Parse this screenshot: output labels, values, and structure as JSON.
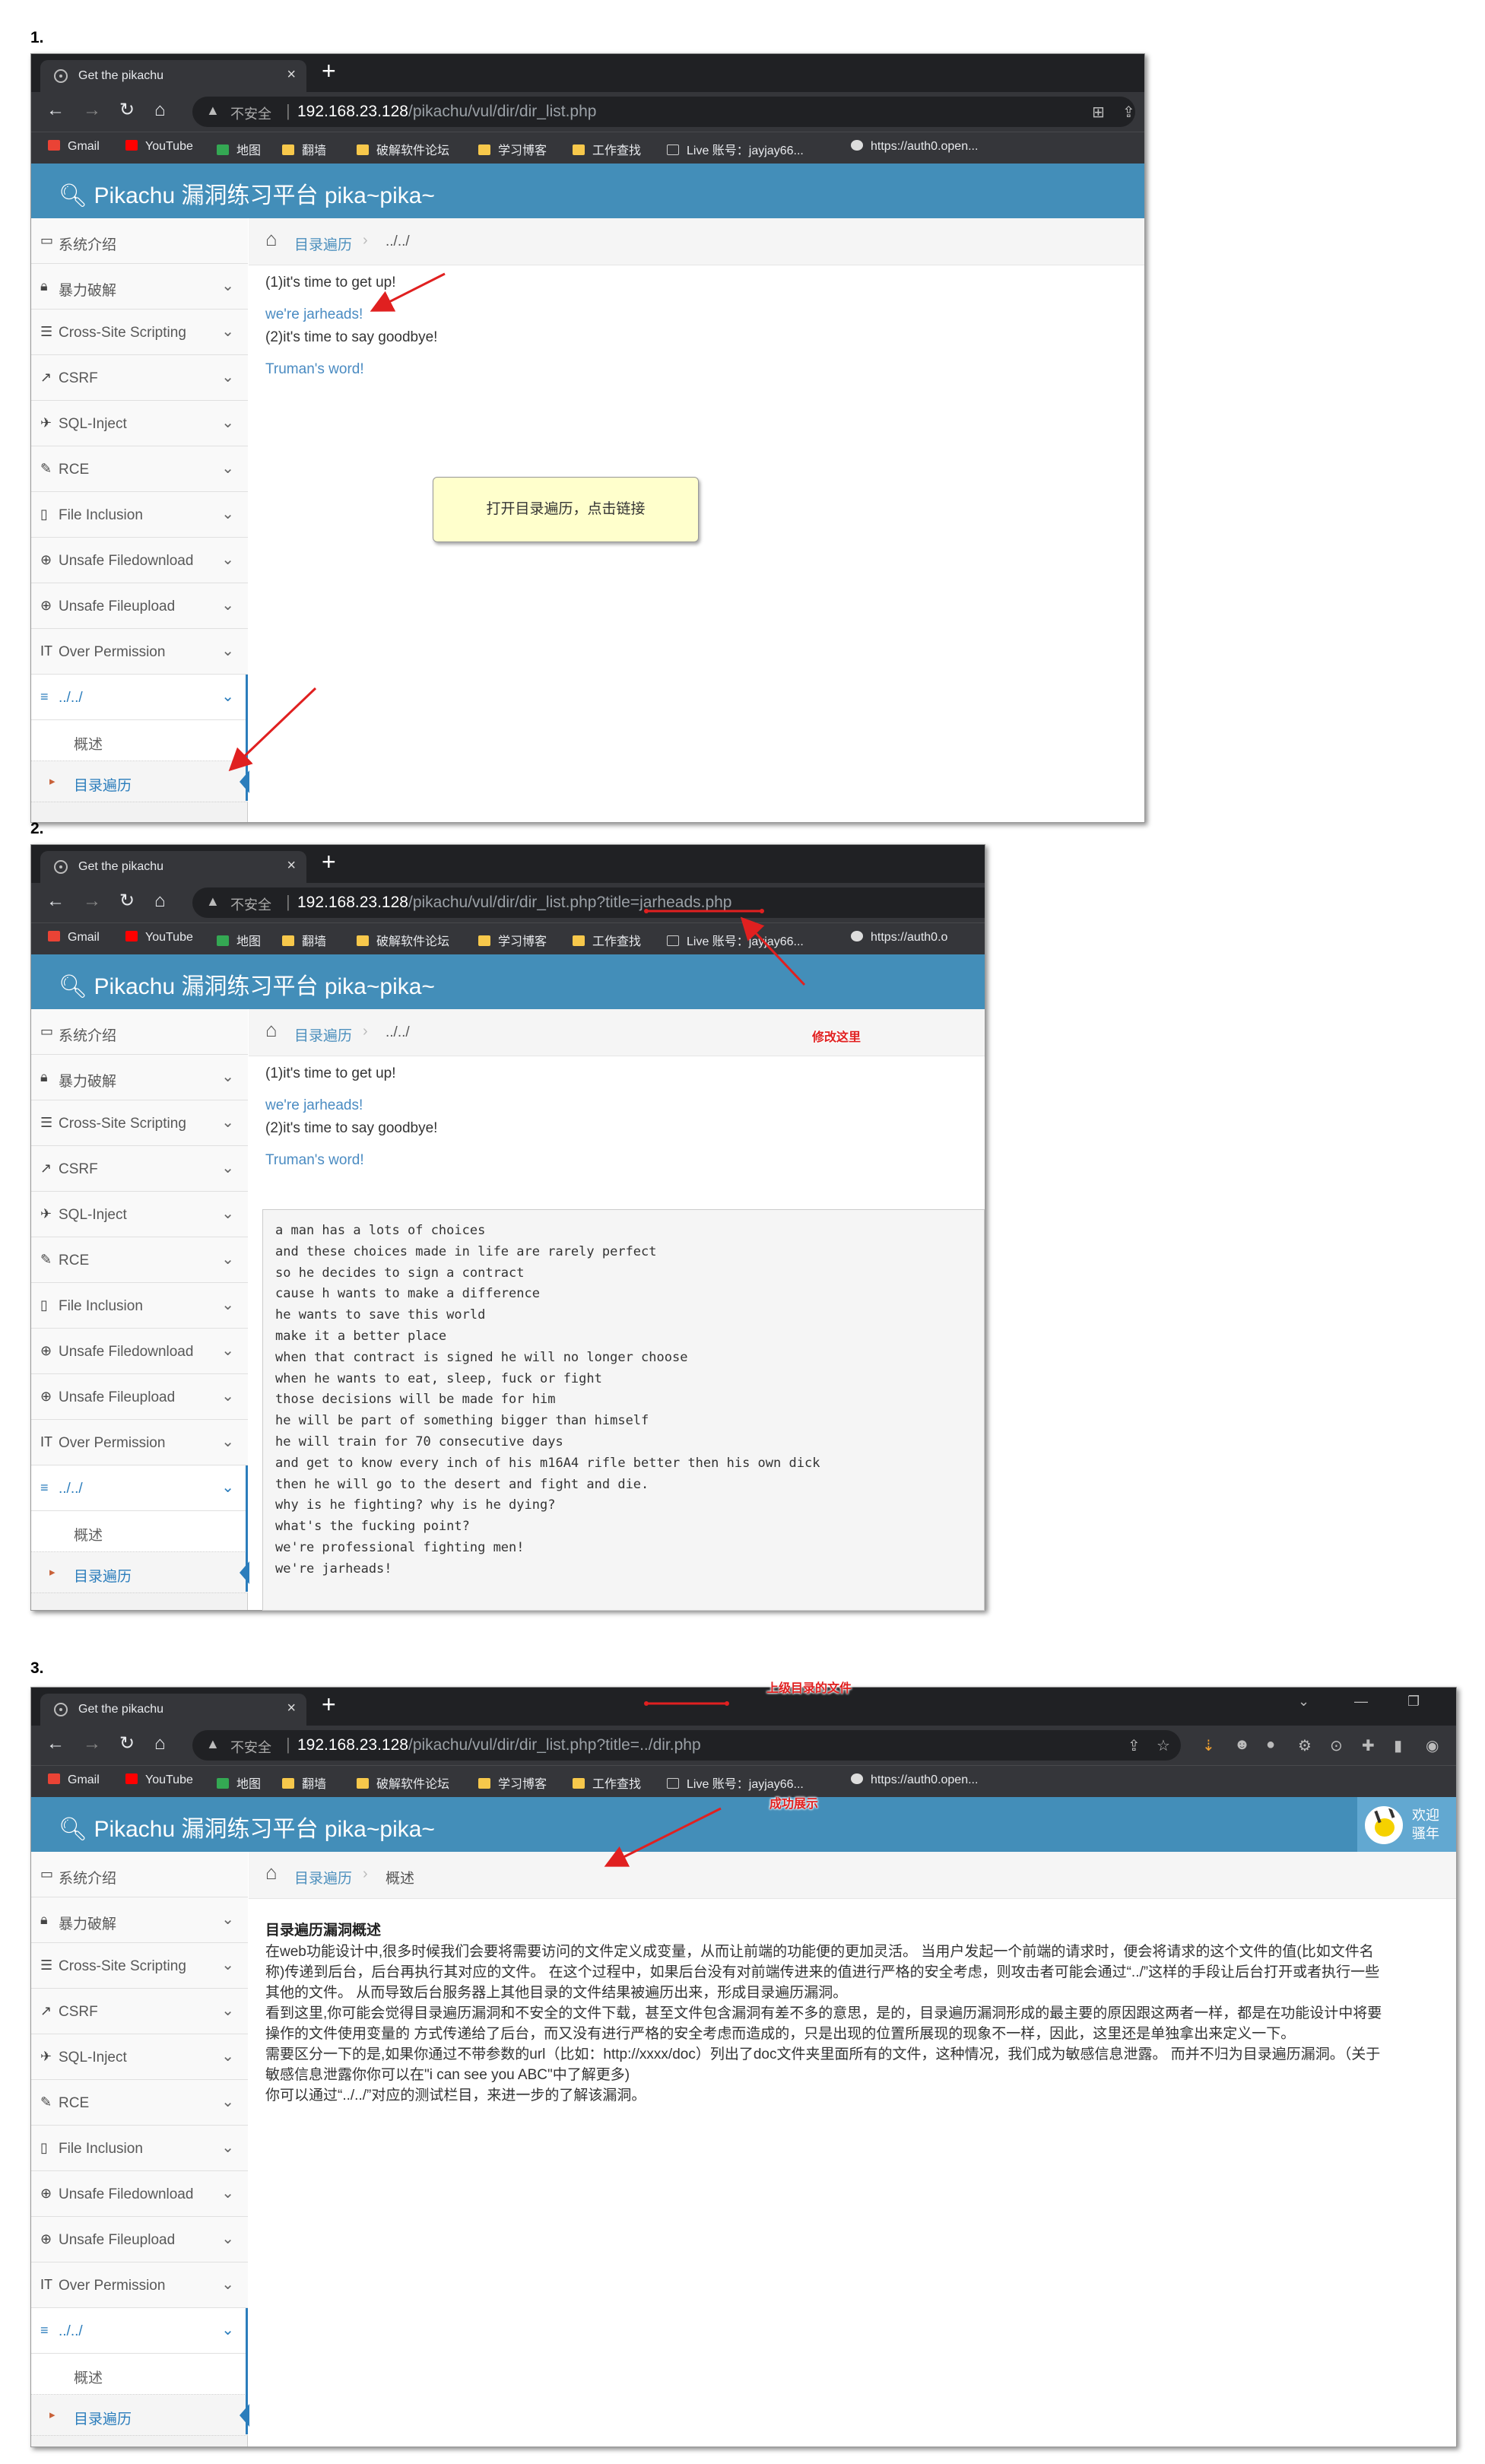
{
  "steps": [
    {
      "number": "1."
    },
    {
      "number": "2."
    },
    {
      "number": "3."
    }
  ],
  "browser": {
    "tab_title": "Get the pikachu",
    "not_secure": "不安全",
    "url_host": "192.168.23.128",
    "urls": [
      "/pikachu/vul/dir/dir_list.php",
      "/pikachu/vul/dir/dir_list.php?title=jarheads.php",
      "/pikachu/vul/dir/dir_list.php?title=../dir.php"
    ],
    "bookmarks": [
      "Gmail",
      "YouTube",
      "地图",
      "翻墙",
      "破解软件论坛",
      "学习博客",
      "工作查找",
      "Live 账号：jayjay66...",
      "https://auth0.open..."
    ],
    "bookmarks_short": [
      "Gmail",
      "YouTube",
      "地图",
      "翻墙",
      "破解软件论坛",
      "学习博客",
      "工作查找",
      "Live 账号：jayjay66...",
      "https://auth0.o"
    ]
  },
  "app": {
    "title": "Pikachu 漏洞练习平台 pika~pika~",
    "welcome": "欢迎",
    "user": "骚年"
  },
  "sidebar": {
    "items": [
      {
        "label": "系统介绍",
        "icon": "desktop-icon"
      },
      {
        "label": "暴力破解",
        "icon": "lock-icon"
      },
      {
        "label": "Cross-Site Scripting",
        "icon": "list-icon"
      },
      {
        "label": "CSRF",
        "icon": "share-icon"
      },
      {
        "label": "SQL-Inject",
        "icon": "fighter-jet-icon"
      },
      {
        "label": "RCE",
        "icon": "pencil-icon"
      },
      {
        "label": "File Inclusion",
        "icon": "file-icon"
      },
      {
        "label": "Unsafe Filedownload",
        "icon": "download-icon"
      },
      {
        "label": "Unsafe Fileupload",
        "icon": "upload-icon"
      },
      {
        "label": "Over Permission",
        "icon": "text-width-icon"
      },
      {
        "label": "../../",
        "icon": "align-left-icon"
      }
    ],
    "sub_items": [
      "概述",
      "目录遍历"
    ]
  },
  "breadcrumb": {
    "section": "目录遍历",
    "pages": [
      "../../",
      "../../",
      "概述"
    ]
  },
  "page": {
    "line1": "(1)it's time to get up!",
    "link1": "we're jarheads!",
    "line2": "(2)it's time to say goodbye!",
    "link2": "Truman's word!",
    "note": "打开目录遍历，点击链接",
    "poem": "a man has a lots of choices\nand these choices made in life are rarely perfect\nso he decides to sign a contract\ncause h wants to make a difference\nhe wants to save this world\nmake it a better place\nwhen that contract is signed he will no longer choose\nwhen he wants to eat, sleep, fuck or fight\nthose decisions will be made for him\nhe will be part of something bigger than himself\nhe will train for 70 consecutive days\nand get to know every inch of his m16A4 rifle better then his own dick\nthen he will go to the desert and fight and die.\nwhy is he fighting? why is he dying?\nwhat's the fucking point?\nwe're professional fighting men!\nwe're jarheads!"
  },
  "overview": {
    "heading": "目录遍历漏洞概述",
    "p1": "在web功能设计中,很多时候我们会要将需要访问的文件定义成变量，从而让前端的功能便的更加灵活。 当用户发起一个前端的请求时，便会将请求的这个文件的值(比如文件名称)传递到后台，后台再执行其对应的文件。 在这个过程中，如果后台没有对前端传进来的值进行严格的安全考虑，则攻击者可能会通过“../”这样的手段让后台打开或者执行一些其他的文件。 从而导致后台服务器上其他目录的文件结果被遍历出来，形成目录遍历漏洞。",
    "p2": "看到这里,你可能会觉得目录遍历漏洞和不安全的文件下载，甚至文件包含漏洞有差不多的意思，是的，目录遍历漏洞形成的最主要的原因跟这两者一样，都是在功能设计中将要操作的文件使用变量的 方式传递给了后台，而又没有进行严格的安全考虑而造成的，只是出现的位置所展现的现象不一样，因此，这里还是单独拿出来定义一下。",
    "p3": "需要区分一下的是,如果你通过不带参数的url（比如：http://xxxx/doc）列出了doc文件夹里面所有的文件，这种情况，我们成为敏感信息泄露。 而并不归为目录遍历漏洞。（关于敏感信息泄露你你可以在\"i can see you ABC\"中了解更多)",
    "p4": "你可以通过“../../”对应的测试栏目，来进一步的了解该漏洞。"
  },
  "annotations": {
    "modify_here": "修改这里",
    "parent_file": "上级目录的文件",
    "success": "成功展示"
  },
  "colors": {
    "header": "#438eb9",
    "link": "#4a8bc2",
    "arrow": "#e02020",
    "note_bg": "#ffffcc"
  }
}
